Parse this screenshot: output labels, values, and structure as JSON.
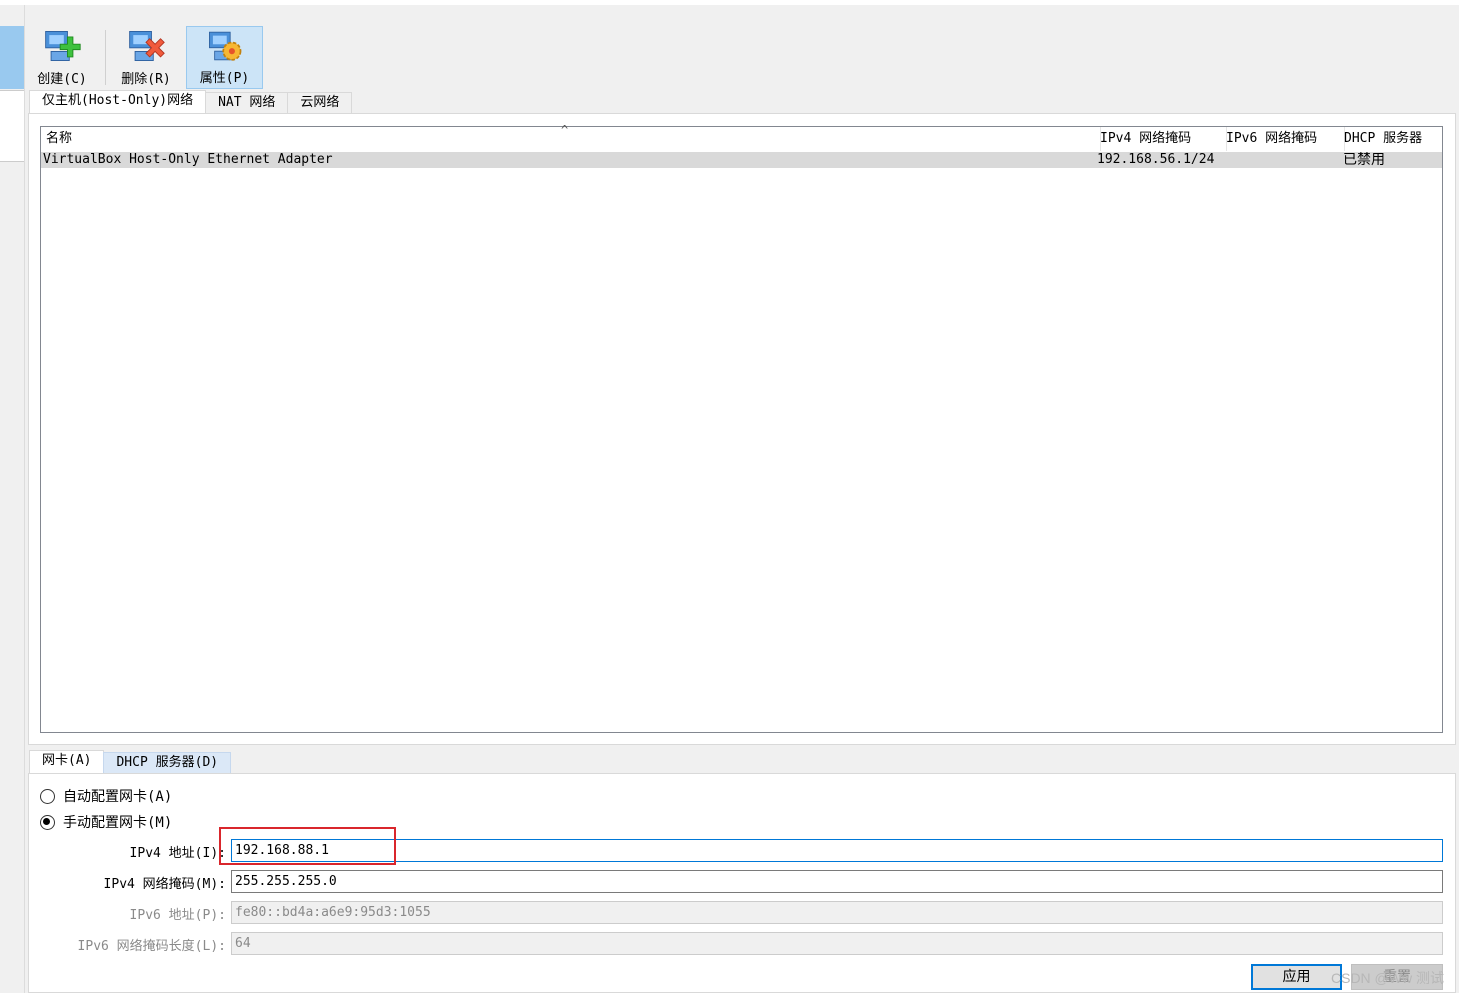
{
  "toolbar": {
    "create_label": "创建(C)",
    "delete_label": "删除(R)",
    "properties_label": "属性(P)"
  },
  "top_tabs": [
    {
      "label": "仅主机(Host-Only)网络",
      "selected": true
    },
    {
      "label": "NAT 网络",
      "selected": false
    },
    {
      "label": "云网络",
      "selected": false
    }
  ],
  "network_list": {
    "headers": {
      "name": "名称",
      "ipv4": "IPv4 网络掩码",
      "ipv6": "IPv6 网络掩码",
      "dhcp": "DHCP 服务器"
    },
    "sort_indicator": "^",
    "rows": [
      {
        "name": "VirtualBox Host-Only Ethernet Adapter",
        "ipv4": "192.168.56.1/24",
        "ipv6": "",
        "dhcp": "已禁用"
      }
    ]
  },
  "detail_tabs": [
    {
      "label": "网卡(A)",
      "selected": true
    },
    {
      "label": "DHCP 服务器(D)",
      "selected": false
    }
  ],
  "adapter": {
    "auto_label": "自动配置网卡(A)",
    "manual_label": "手动配置网卡(M)",
    "manual_selected": true,
    "ipv4_addr_label": "IPv4 地址(I):",
    "ipv4_addr_value": "192.168.88.1",
    "ipv4_mask_label": "IPv4 网络掩码(M):",
    "ipv4_mask_value": "255.255.255.0",
    "ipv6_addr_label": "IPv6 地址(P):",
    "ipv6_addr_value": "fe80::bd4a:a6e9:95d3:1055",
    "ipv6_len_label": "IPv6 网络掩码长度(L):",
    "ipv6_len_value": "64"
  },
  "buttons": {
    "apply_label": "应用",
    "reset_label": "重置"
  },
  "watermark": "CSDN @Ww 测试",
  "colors": {
    "highlight_box": "#d9262c",
    "focus_border": "#0078d7",
    "selection_row": "#d9d9d9"
  }
}
